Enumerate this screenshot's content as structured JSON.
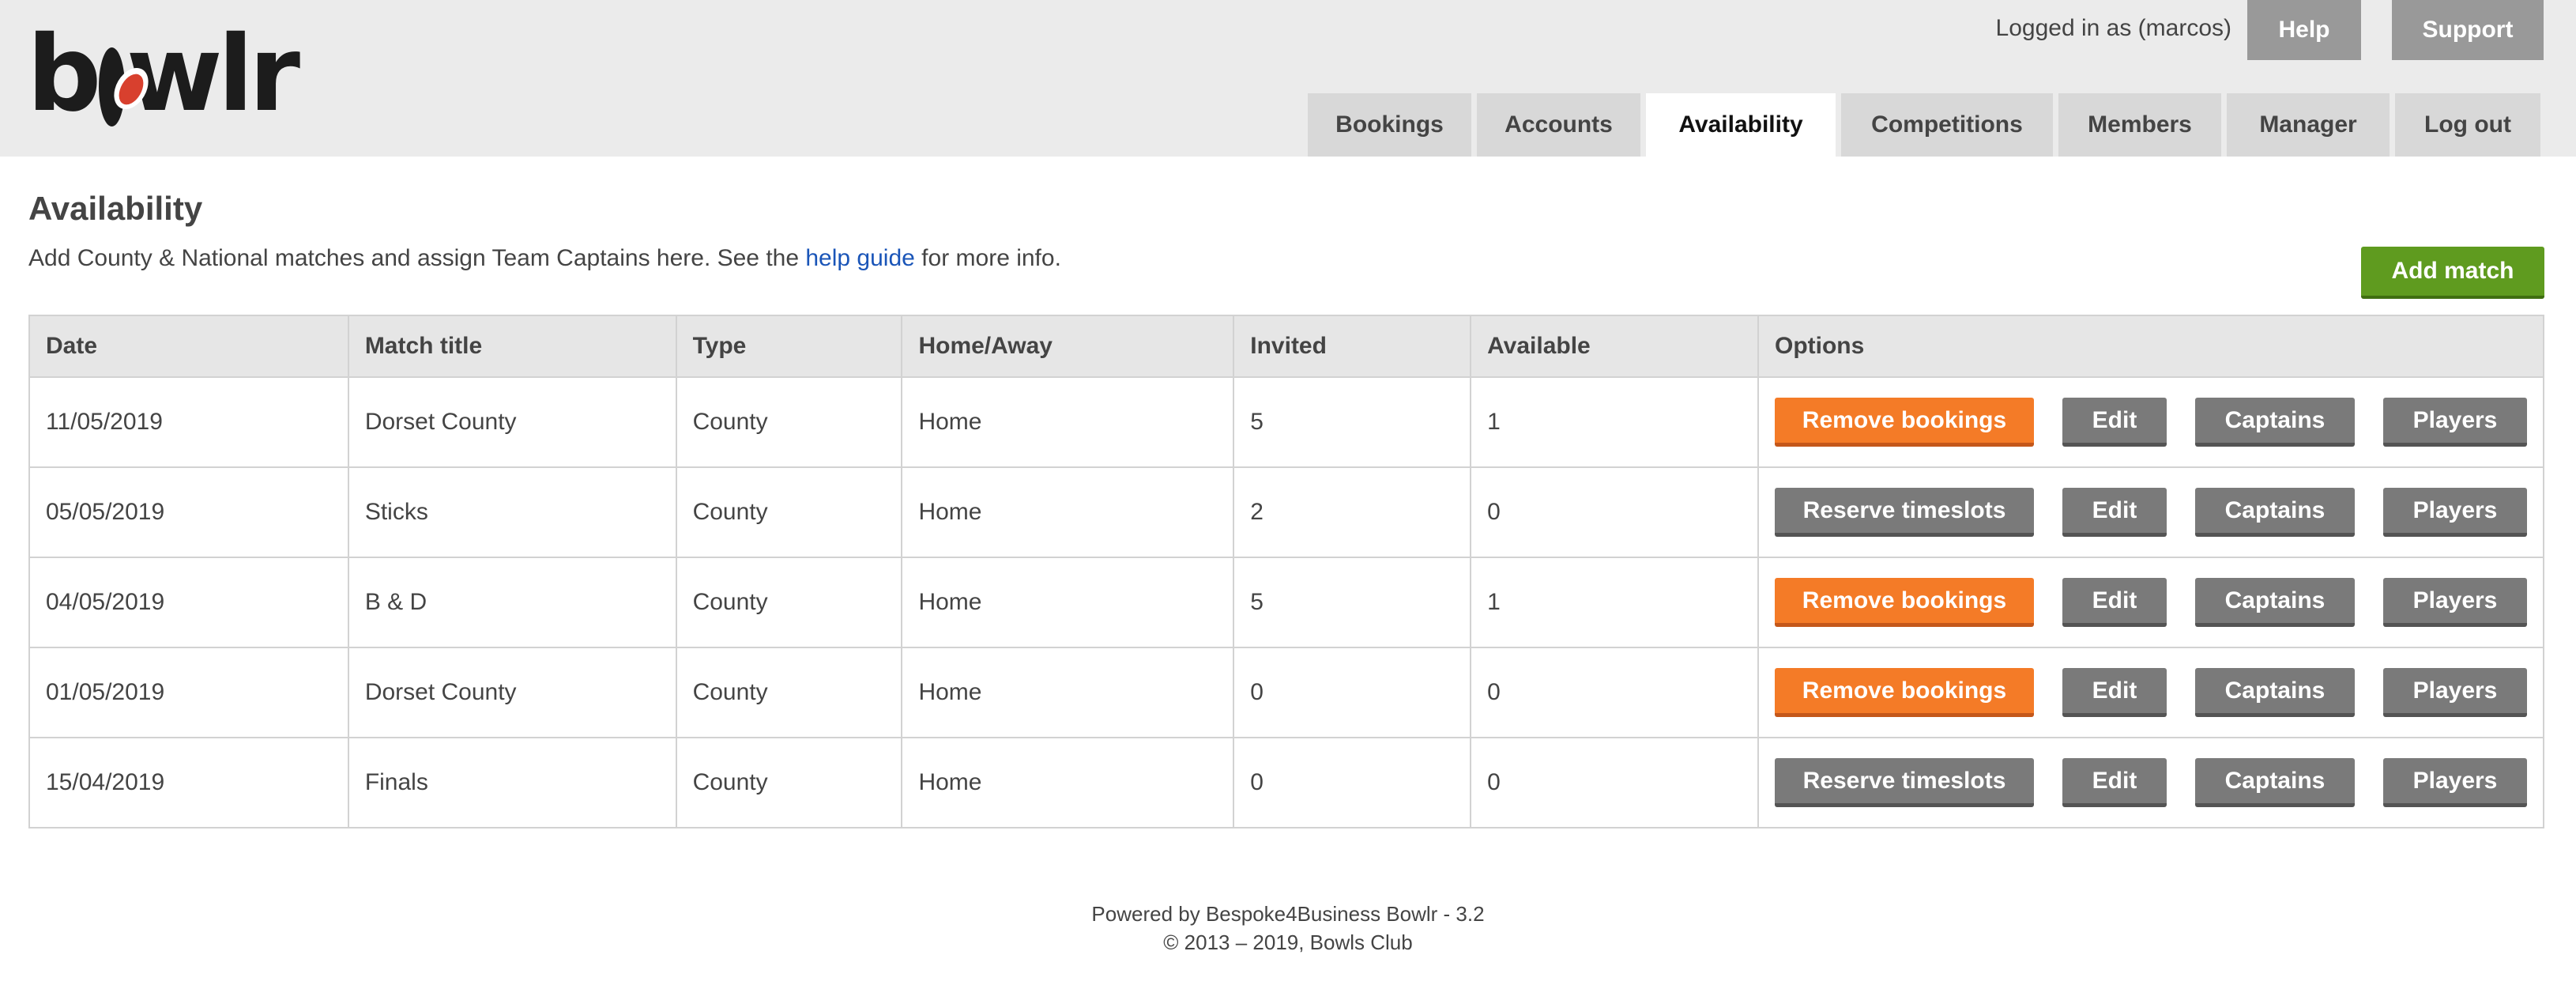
{
  "logo": "bowlr",
  "header": {
    "login_text": "Logged in as (marcos)",
    "help": "Help",
    "support": "Support"
  },
  "nav": {
    "bookings": "Bookings",
    "accounts": "Accounts",
    "availability": "Availability",
    "competitions": "Competitions",
    "members": "Members",
    "manager": "Manager",
    "logout": "Log out",
    "active": "Availability"
  },
  "page": {
    "title": "Availability",
    "intro_before": "Add County & National matches and assign Team Captains here. See the ",
    "intro_link": "help guide",
    "intro_after": " for more info.",
    "add_match": "Add match"
  },
  "table": {
    "headers": [
      "Date",
      "Match title",
      "Type",
      "Home/Away",
      "Invited",
      "Available",
      "Options"
    ],
    "rows": [
      {
        "date": "11/05/2019",
        "title": "Dorset County",
        "type": "County",
        "homeaway": "Home",
        "invited": "5",
        "available": "1",
        "primary": "Remove bookings",
        "edit": "Edit",
        "captains": "Captains",
        "players": "Players"
      },
      {
        "date": "05/05/2019",
        "title": "Sticks",
        "type": "County",
        "homeaway": "Home",
        "invited": "2",
        "available": "0",
        "primary": "Reserve timeslots",
        "edit": "Edit",
        "captains": "Captains",
        "players": "Players"
      },
      {
        "date": "04/05/2019",
        "title": "B & D",
        "type": "County",
        "homeaway": "Home",
        "invited": "5",
        "available": "1",
        "primary": "Remove bookings",
        "edit": "Edit",
        "captains": "Captains",
        "players": "Players"
      },
      {
        "date": "01/05/2019",
        "title": "Dorset County",
        "type": "County",
        "homeaway": "Home",
        "invited": "0",
        "available": "0",
        "primary": "Remove bookings",
        "edit": "Edit",
        "captains": "Captains",
        "players": "Players"
      },
      {
        "date": "15/04/2019",
        "title": "Finals",
        "type": "County",
        "homeaway": "Home",
        "invited": "0",
        "available": "0",
        "primary": "Reserve timeslots",
        "edit": "Edit",
        "captains": "Captains",
        "players": "Players"
      }
    ]
  },
  "footer": {
    "line1": "Powered by Bespoke4Business Bowlr - 3.2",
    "line2": "© 2013 – 2019, Bowls Club"
  },
  "colors": {
    "remove_button": "#f47b27",
    "grey_button": "#7a7a7a",
    "add_match_button": "#5f9b1f",
    "link": "#1a55b8"
  }
}
